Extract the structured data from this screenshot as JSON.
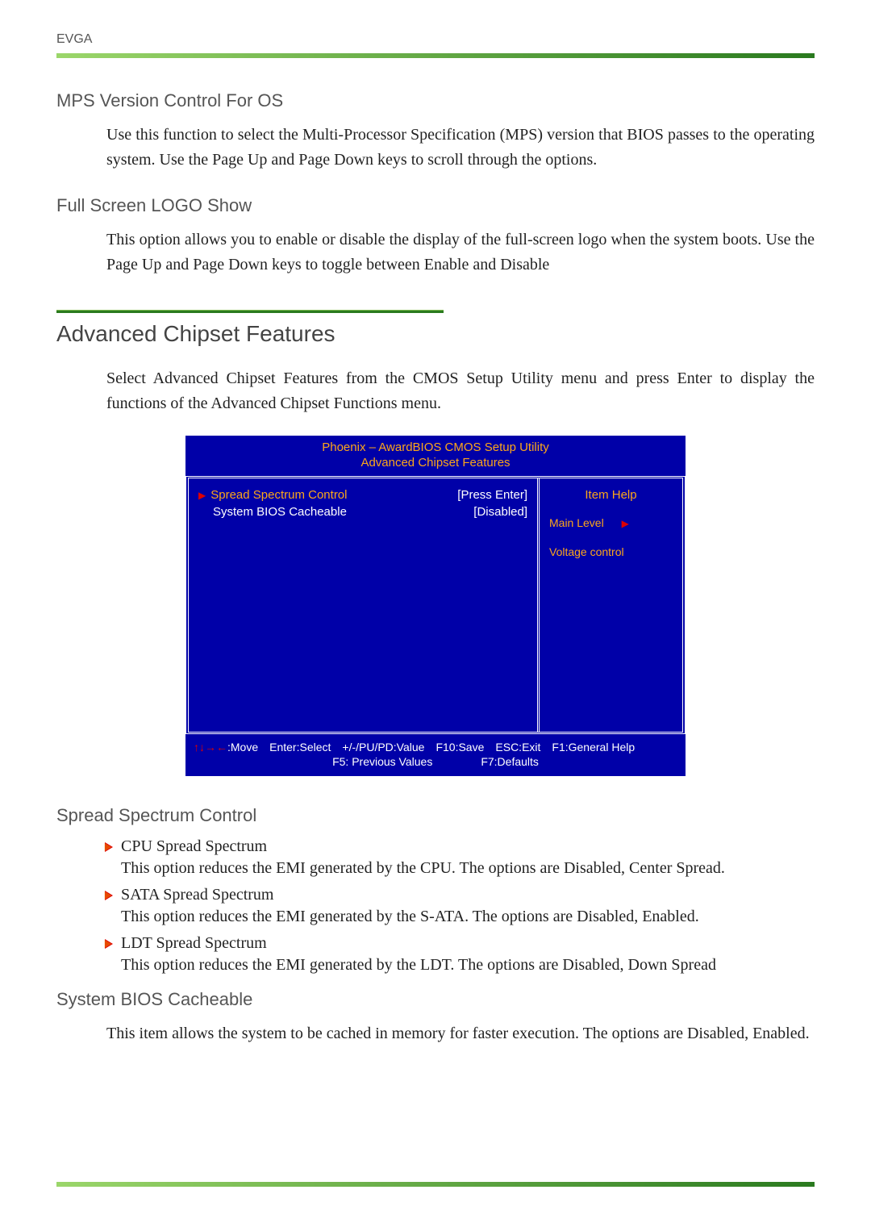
{
  "brand": "EVGA",
  "sections": {
    "mps": {
      "title": "MPS Version Control For OS",
      "body": "Use this function to select the Multi-Processor Specification (MPS) version that BIOS passes to the operating system. Use the Page Up and Page Down keys to scroll through the options."
    },
    "logo": {
      "title": "Full Screen LOGO Show",
      "body": "This option allows you to enable or disable the display of the full-screen logo when the system boots. Use the Page Up and Page Down keys to toggle between Enable and Disable"
    },
    "acf": {
      "title": "Advanced Chipset Features",
      "intro": "Select Advanced Chipset Features from the CMOS Setup Utility menu and press Enter to display the functions of the Advanced Chipset Functions menu."
    },
    "ssc": {
      "title": "Spread Spectrum Control",
      "items": [
        {
          "head": "CPU Spread Spectrum",
          "body": "This option reduces the EMI generated by the CPU.  The options are Disabled, Center Spread."
        },
        {
          "head": "SATA Spread Spectrum",
          "body": "This option reduces the EMI generated by the S-ATA. The options are Disabled, Enabled."
        },
        {
          "head": "LDT Spread Spectrum",
          "body": "This option reduces the EMI generated by the LDT. The options are Disabled, Down Spread"
        }
      ]
    },
    "sbc": {
      "title": "System BIOS Cacheable",
      "body": "This item allows the system to be cached in memory for faster execution. The options are Disabled, Enabled."
    }
  },
  "bios": {
    "title1": "Phoenix – AwardBIOS CMOS Setup Utility",
    "title2": "Advanced Chipset Features",
    "rows": [
      {
        "label": "Spread Spectrum Control",
        "value": "[Press Enter]",
        "selected": true
      },
      {
        "label": "System BIOS Cacheable",
        "value": "[Disabled]",
        "selected": false
      }
    ],
    "help": {
      "title": "Item Help",
      "main_level": "Main Level",
      "vc": "Voltage control"
    },
    "footer": {
      "arrows": "↑↓→←",
      "move": ":Move",
      "enter": "Enter:Select",
      "pupd": "+/-/PU/PD:Value",
      "f10": "F10:Save",
      "esc": "ESC:Exit",
      "f1": "F1:General Help",
      "f5": "F5: Previous Values",
      "f7": "F7:Defaults"
    }
  }
}
